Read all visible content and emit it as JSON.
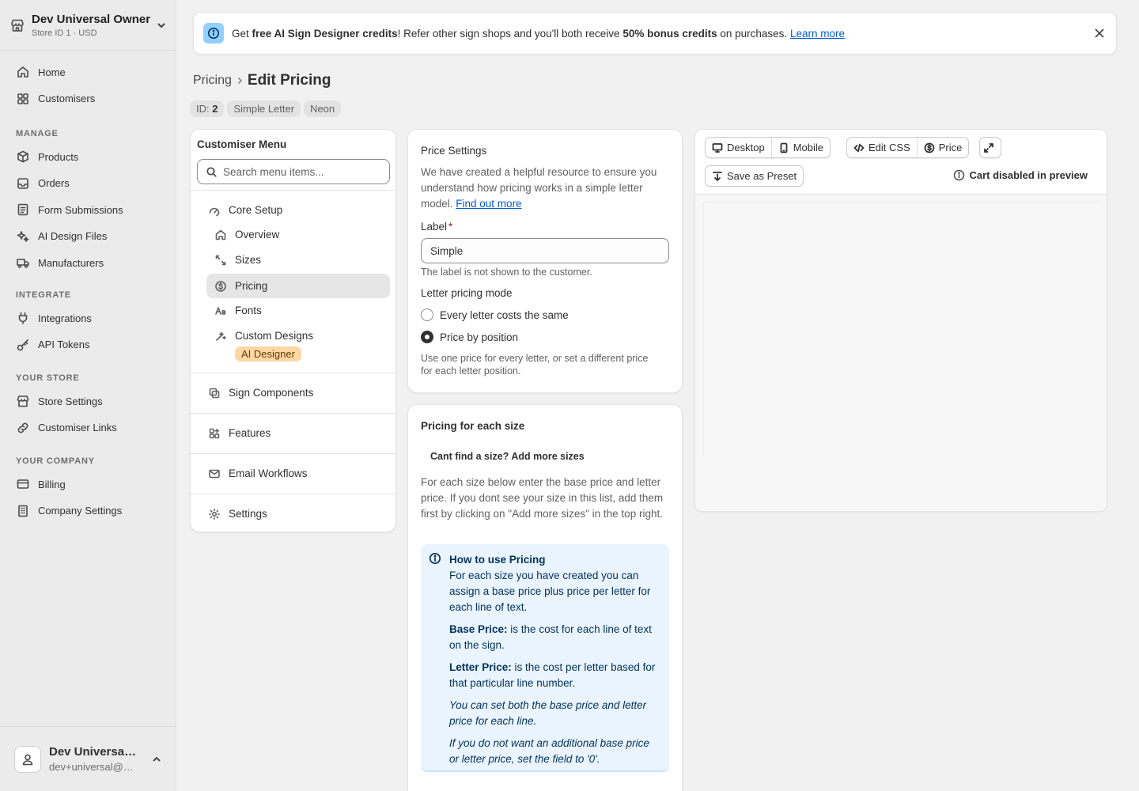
{
  "store": {
    "name": "Dev Universal Owner",
    "sub": "Store ID 1 · USD"
  },
  "nav": {
    "home": "Home",
    "customisers": "Customisers",
    "manage_head": "MANAGE",
    "products": "Products",
    "orders": "Orders",
    "form_submissions": "Form Submissions",
    "ai_design_files": "AI Design Files",
    "manufacturers": "Manufacturers",
    "integrate_head": "INTEGRATE",
    "integrations": "Integrations",
    "api_tokens": "API Tokens",
    "store_head": "YOUR STORE",
    "store_settings": "Store Settings",
    "customiser_links": "Customiser Links",
    "company_head": "YOUR COMPANY",
    "billing": "Billing",
    "company_settings": "Company Settings"
  },
  "user": {
    "name": "Dev Universal Owner",
    "email": "dev+universal@example.com"
  },
  "banner": {
    "t1": "Get ",
    "b1": "free AI Sign Designer credits",
    "t2": "! Refer other sign shops and you'll both receive ",
    "b2": "50% bonus credits",
    "t3": " on purchases. ",
    "link": "Learn more"
  },
  "breadcrumb": {
    "parent": "Pricing",
    "current": "Edit Pricing"
  },
  "tags": {
    "id_label": "ID: ",
    "id_value": "2",
    "type": "Simple Letter",
    "category": "Neon"
  },
  "menu": {
    "title": "Customiser Menu",
    "search_placeholder": "Search menu items...",
    "core_setup": "Core Setup",
    "overview": "Overview",
    "sizes": "Sizes",
    "pricing": "Pricing",
    "fonts": "Fonts",
    "custom_designs": "Custom Designs",
    "ai_badge": "AI Designer",
    "sign_components": "Sign Components",
    "features": "Features",
    "email_workflows": "Email Workflows",
    "settings": "Settings"
  },
  "price_settings": {
    "title": "Price Settings",
    "desc": "We have created a helpful resource to ensure you understand how pricing works in a simple letter model. ",
    "desc_link": "Find out more",
    "label_title": "Label",
    "label_required": "*",
    "label_value": "Simple",
    "label_help": "The label is not shown to the customer.",
    "mode_title": "Letter pricing mode",
    "mode_same": "Every letter costs the same",
    "mode_position": "Price by position",
    "mode_selected": "position",
    "mode_help": "Use one price for every letter, or set a different price for each letter position."
  },
  "size_pricing": {
    "title": "Pricing for each size",
    "add_sizes": "Cant find a size? Add more sizes",
    "desc": "For each size below enter the base price and letter price. If you dont see your size in this list, add them first by clicking on \"Add more sizes\" in the top right.",
    "howto_title": "How to use Pricing",
    "howto_p1": "For each size you have created you can assign a base price plus price per letter for each line of text.",
    "base_label": "Base Price:",
    "base_text": " is the cost for each line of text on the sign.",
    "letter_label": "Letter Price:",
    "letter_text": " is the cost per letter based for that particular line number.",
    "italic1": "You can set both the base price and letter price for each line.",
    "italic2": "If you do not want an additional base price or letter price, set the field to '0'."
  },
  "preview": {
    "desktop": "Desktop",
    "mobile": "Mobile",
    "edit_css": "Edit CSS",
    "price": "Price",
    "save_preset": "Save as Preset",
    "cart_note": "Cart disabled in preview"
  },
  "colors": {
    "accent_link": "#005bd3",
    "banner_icon_bg": "#91d0ff",
    "ai_badge_bg": "#ffd6a4",
    "info_bg": "#eaf4ff"
  }
}
